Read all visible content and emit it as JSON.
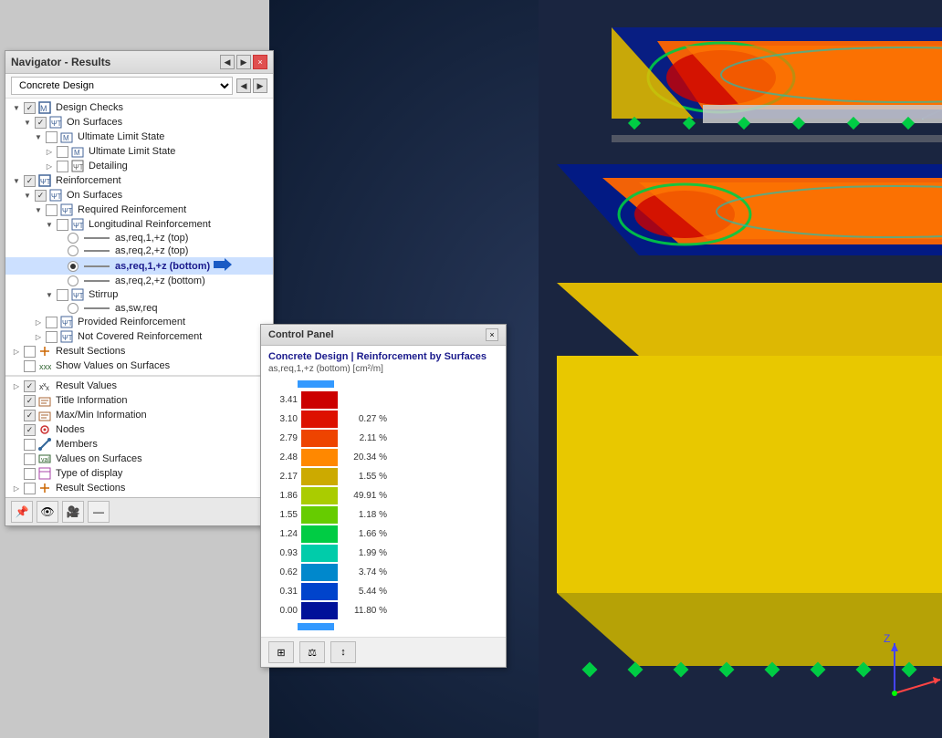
{
  "navigator": {
    "title": "Navigator - Results",
    "dropdown": "Concrete Design",
    "close_label": "×",
    "prev_label": "◀",
    "next_label": "▶",
    "tree": {
      "design_checks": "Design Checks",
      "on_surfaces_1": "On Surfaces",
      "ultimate_limit_state_1": "Ultimate Limit State",
      "ultimate_limit_state_2": "Ultimate Limit State",
      "detailing": "Detailing",
      "reinforcement": "Reinforcement",
      "on_surfaces_2": "On Surfaces",
      "required_reinforcement": "Required Reinforcement",
      "longitudinal_reinforcement": "Longitudinal Reinforcement",
      "as_req1_top": "as,req,1,+z (top)",
      "as_req2_top": "as,req,2,+z (top)",
      "as_req1_bottom": "as,req,1,+z (bottom)",
      "as_req2_bottom": "as,req,2,+z (bottom)",
      "stirrup": "Stirrup",
      "as_sw_req": "as,sw,req",
      "provided_reinforcement": "Provided Reinforcement",
      "not_covered_reinforcement": "Not Covered Reinforcement",
      "result_sections": "Result Sections",
      "show_values_on_surfaces": "Show Values on Surfaces",
      "result_values": "Result Values",
      "title_information": "Title Information",
      "maxmin_information": "Max/Min Information",
      "nodes": "Nodes",
      "members": "Members",
      "values_on_surfaces": "Values on Surfaces",
      "type_of_display": "Type of display",
      "result_sections_2": "Result Sections"
    },
    "toolbar": {
      "btn1": "📌",
      "btn2": "👁",
      "btn3": "🎥",
      "btn4": "—"
    }
  },
  "control_panel": {
    "title": "Control Panel",
    "subtitle": "Concrete Design | Reinforcement by Surfaces",
    "subtitle2": "as,req,1,+z (bottom) [cm²/m]",
    "legend": [
      {
        "value": "3.41",
        "color": "#cc0000",
        "pct": "",
        "indicator": true
      },
      {
        "value": "3.10",
        "color": "#dd1100",
        "pct": "0.27 %"
      },
      {
        "value": "2.79",
        "color": "#ee4400",
        "pct": "2.11 %"
      },
      {
        "value": "2.48",
        "color": "#ff8800",
        "pct": "20.34 %"
      },
      {
        "value": "2.17",
        "color": "#ccaa00",
        "pct": "1.55 %"
      },
      {
        "value": "1.86",
        "color": "#aacc00",
        "pct": "49.91 %"
      },
      {
        "value": "1.55",
        "color": "#66cc00",
        "pct": "1.18 %"
      },
      {
        "value": "1.24",
        "color": "#00cc44",
        "pct": "1.66 %"
      },
      {
        "value": "0.93",
        "color": "#00ccaa",
        "pct": "1.99 %"
      },
      {
        "value": "0.62",
        "color": "#0088cc",
        "pct": "3.74 %"
      },
      {
        "value": "0.31",
        "color": "#0044cc",
        "pct": "5.44 %"
      },
      {
        "value": "0.00",
        "color": "#001199",
        "pct": "11.80 %"
      },
      {
        "value": "",
        "color": "#001155",
        "pct": "",
        "indicator": true
      }
    ],
    "footer_btns": [
      "⊞",
      "⊙",
      "↕"
    ]
  }
}
